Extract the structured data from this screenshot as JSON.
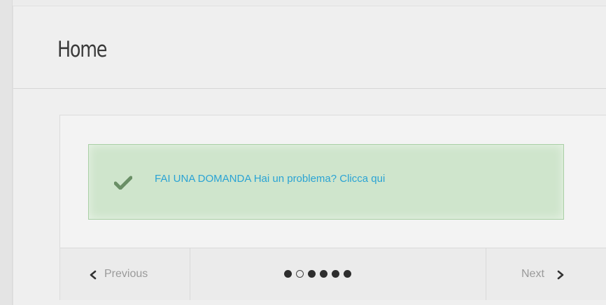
{
  "page": {
    "title": "Home"
  },
  "alert": {
    "text": "FAI UNA DOMANDA Hai un problema? Clicca qui",
    "icon": "check-icon",
    "color": "#2aa3d4",
    "background": "#cfe5cc"
  },
  "carousel": {
    "previous_label": "Previous",
    "next_label": "Next",
    "slides": 6,
    "active_index": 1
  }
}
